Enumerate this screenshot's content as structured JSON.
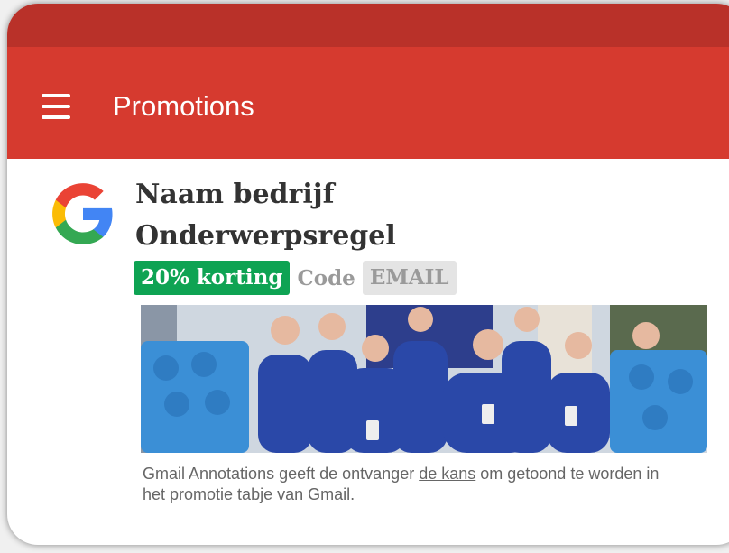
{
  "header": {
    "title": "Promotions",
    "menu_icon": "hamburger-menu-icon",
    "status_bar_color": "#b93129",
    "color": "#d63a2f"
  },
  "email": {
    "sender": "Naam bedrijf",
    "subject": "Onderwerpsregel",
    "avatar_icon": "google-g-logo",
    "discount_badge": "20% korting",
    "discount_color": "#0ea353",
    "code_label": "Code",
    "code_value": "EMAIL",
    "image_icon": "team-photo-image"
  },
  "caption": {
    "text_before": "Gmail Annotations geeft de ontvanger ",
    "link": "de kans",
    "text_after": " om getoond te worden in het promotie tabje van Gmail."
  }
}
